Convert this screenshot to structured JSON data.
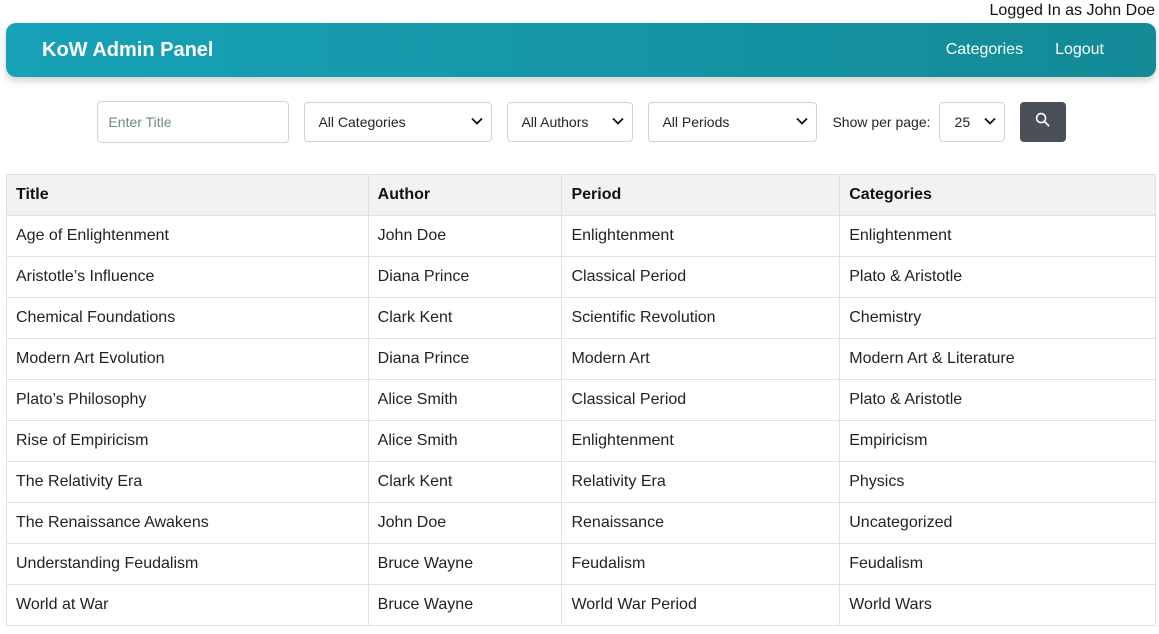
{
  "header": {
    "login_status": "Logged In as John Doe",
    "brand": "KoW Admin Panel",
    "nav": {
      "categories": "Categories",
      "logout": "Logout"
    }
  },
  "filters": {
    "title_placeholder": "Enter Title",
    "category_selected": "All Categories",
    "author_selected": "All Authors",
    "period_selected": "All Periods",
    "per_page_label": "Show per page:",
    "per_page_selected": "25",
    "search_icon": "search-icon"
  },
  "table": {
    "headers": [
      "Title",
      "Author",
      "Period",
      "Categories"
    ],
    "rows": [
      [
        "Age of Enlightenment",
        "John Doe",
        "Enlightenment",
        "Enlightenment"
      ],
      [
        "Aristotle’s Influence",
        "Diana Prince",
        "Classical Period",
        "Plato & Aristotle"
      ],
      [
        "Chemical Foundations",
        "Clark Kent",
        "Scientific Revolution",
        "Chemistry"
      ],
      [
        "Modern Art Evolution",
        "Diana Prince",
        "Modern Art",
        "Modern Art & Literature"
      ],
      [
        "Plato’s Philosophy",
        "Alice Smith",
        "Classical Period",
        "Plato & Aristotle"
      ],
      [
        "Rise of Empiricism",
        "Alice Smith",
        "Enlightenment",
        "Empiricism"
      ],
      [
        "The Relativity Era",
        "Clark Kent",
        "Relativity Era",
        "Physics"
      ],
      [
        "The Renaissance Awakens",
        "John Doe",
        "Renaissance",
        "Uncategorized"
      ],
      [
        "Understanding Feudalism",
        "Bruce Wayne",
        "Feudalism",
        "Feudalism"
      ],
      [
        "World at War",
        "Bruce Wayne",
        "World War Period",
        "World Wars"
      ]
    ]
  },
  "colors": {
    "navbar_start": "#17a2b8",
    "navbar_end": "#138a96",
    "search_button": "#495057",
    "table_header_bg": "#f2f2f2"
  }
}
